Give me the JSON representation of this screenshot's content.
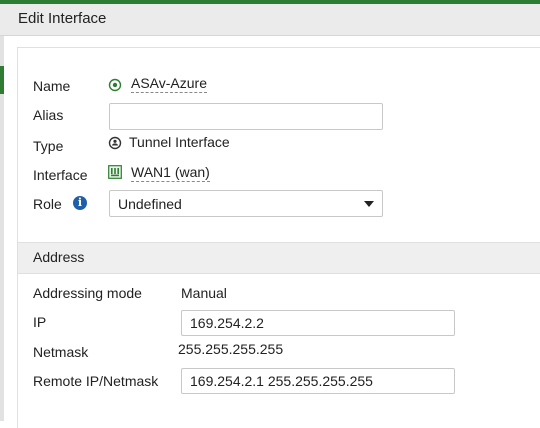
{
  "dialog": {
    "title": "Edit Interface"
  },
  "form": {
    "name": {
      "label": "Name",
      "value": "ASAv-Azure",
      "icon": "tunnel-icon"
    },
    "alias": {
      "label": "Alias",
      "value": ""
    },
    "type": {
      "label": "Type",
      "value": "Tunnel Interface",
      "icon": "tunnel-icon"
    },
    "interface": {
      "label": "Interface",
      "value": "WAN1 (wan)",
      "icon": "port-icon"
    },
    "role": {
      "label": "Role",
      "value": "Undefined",
      "info_icon": "info-icon"
    }
  },
  "address": {
    "header": "Address",
    "addressing_mode": {
      "label": "Addressing mode",
      "value": "Manual"
    },
    "ip": {
      "label": "IP",
      "value": "169.254.2.2"
    },
    "netmask": {
      "label": "Netmask",
      "value": "255.255.255.255"
    },
    "remote": {
      "label": "Remote IP/Netmask",
      "value": "169.254.2.1 255.255.255.255"
    }
  },
  "colors": {
    "accent": "#2e7d32",
    "info": "#1e5fa8"
  }
}
